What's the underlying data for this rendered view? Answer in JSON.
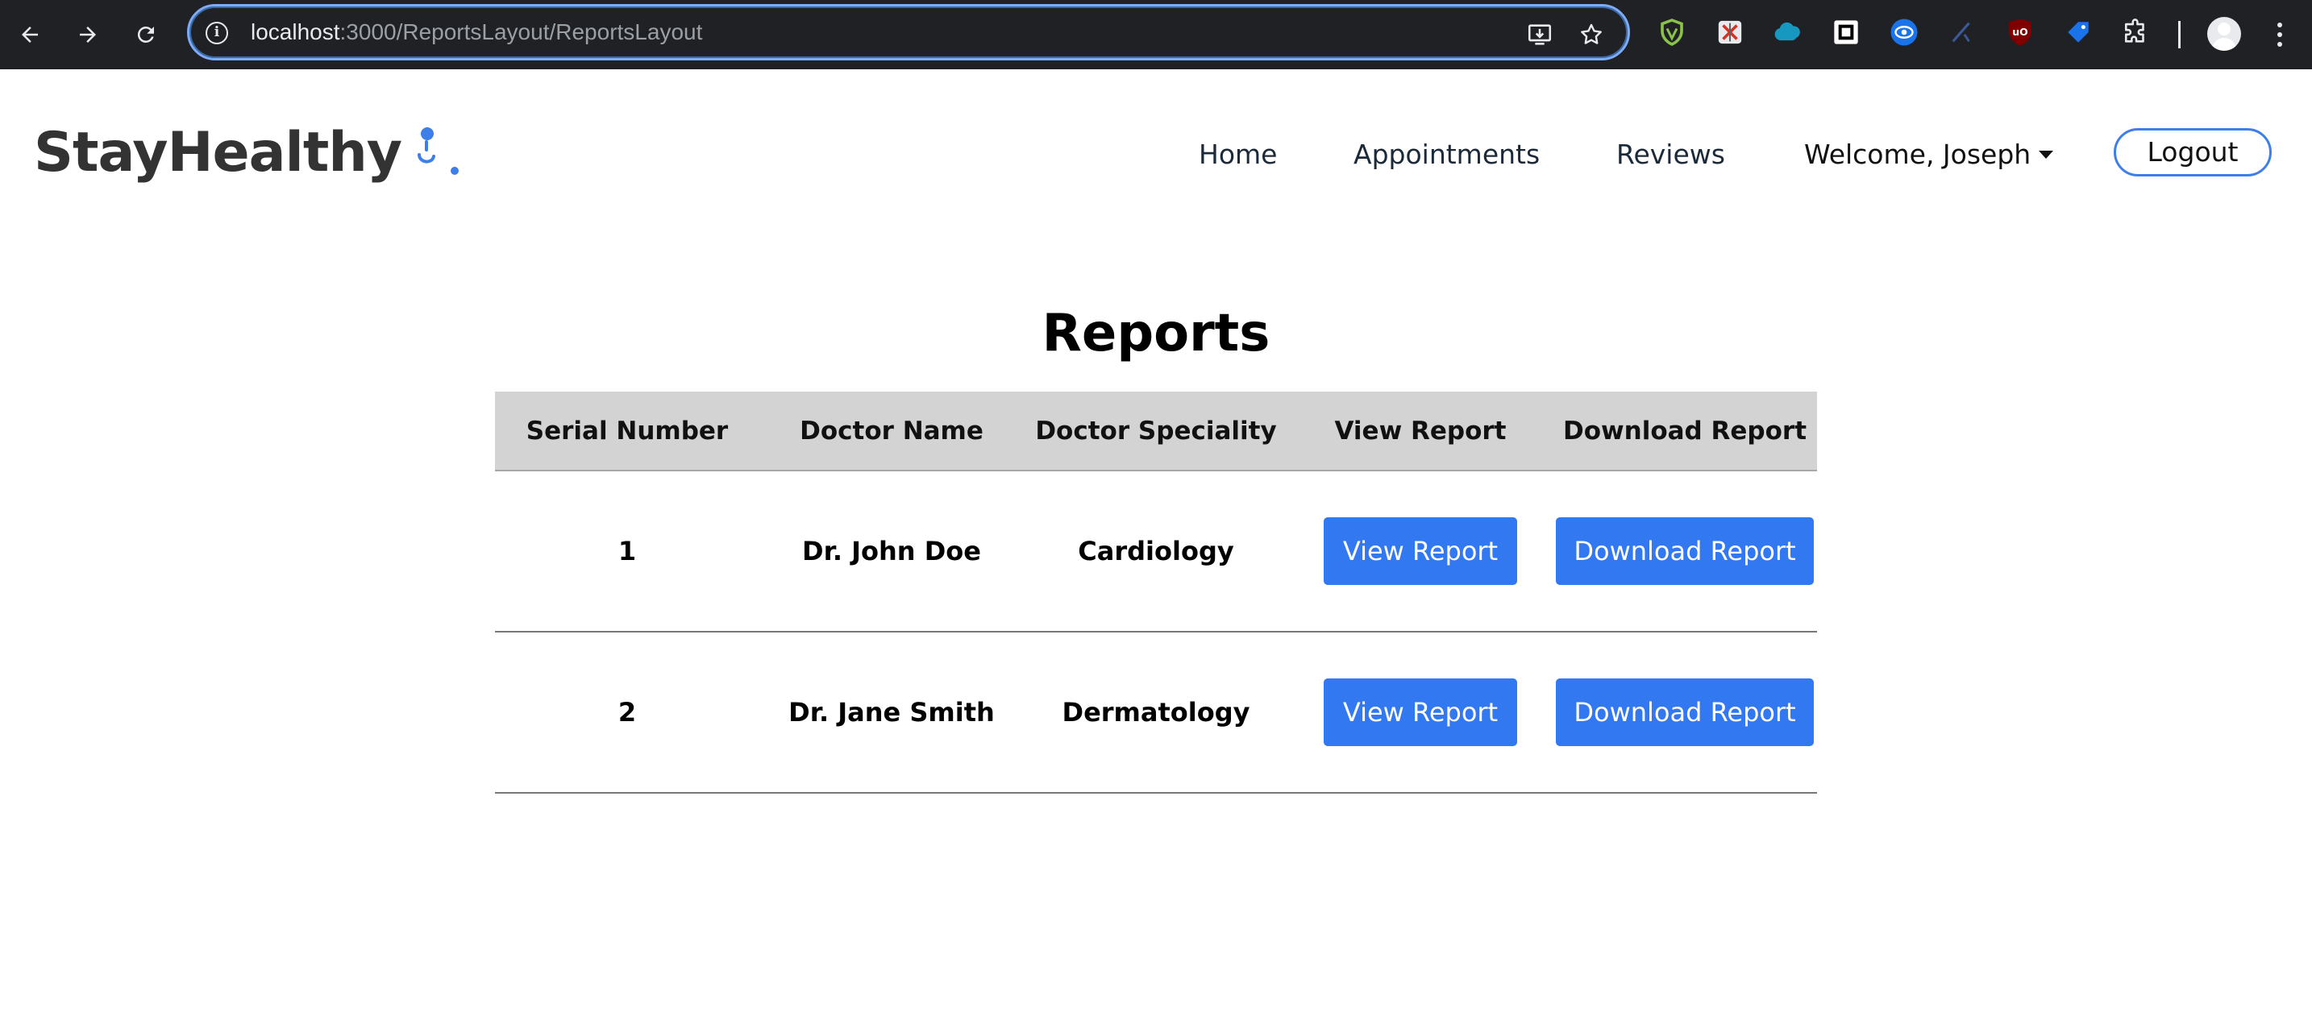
{
  "browser": {
    "url_host": "localhost",
    "url_path": ":3000/ReportsLayout/ReportsLayout"
  },
  "site": {
    "logo_text": "StayHealthy",
    "nav": {
      "home": "Home",
      "appointments": "Appointments",
      "reviews": "Reviews",
      "welcome": "Welcome, Joseph",
      "logout": "Logout"
    }
  },
  "reports": {
    "title": "Reports",
    "columns": [
      "Serial Number",
      "Doctor Name",
      "Doctor Speciality",
      "View Report",
      "Download Report"
    ],
    "rows": [
      {
        "serial": "1",
        "doctor": "Dr. John Doe",
        "speciality": "Cardiology",
        "view_label": "View Report",
        "download_label": "Download Report"
      },
      {
        "serial": "2",
        "doctor": "Dr. Jane Smith",
        "speciality": "Dermatology",
        "view_label": "View Report",
        "download_label": "Download Report"
      }
    ]
  },
  "colors": {
    "accent": "#3278f1",
    "header_bg": "#d3d3d3",
    "browser_bg": "#202124"
  }
}
